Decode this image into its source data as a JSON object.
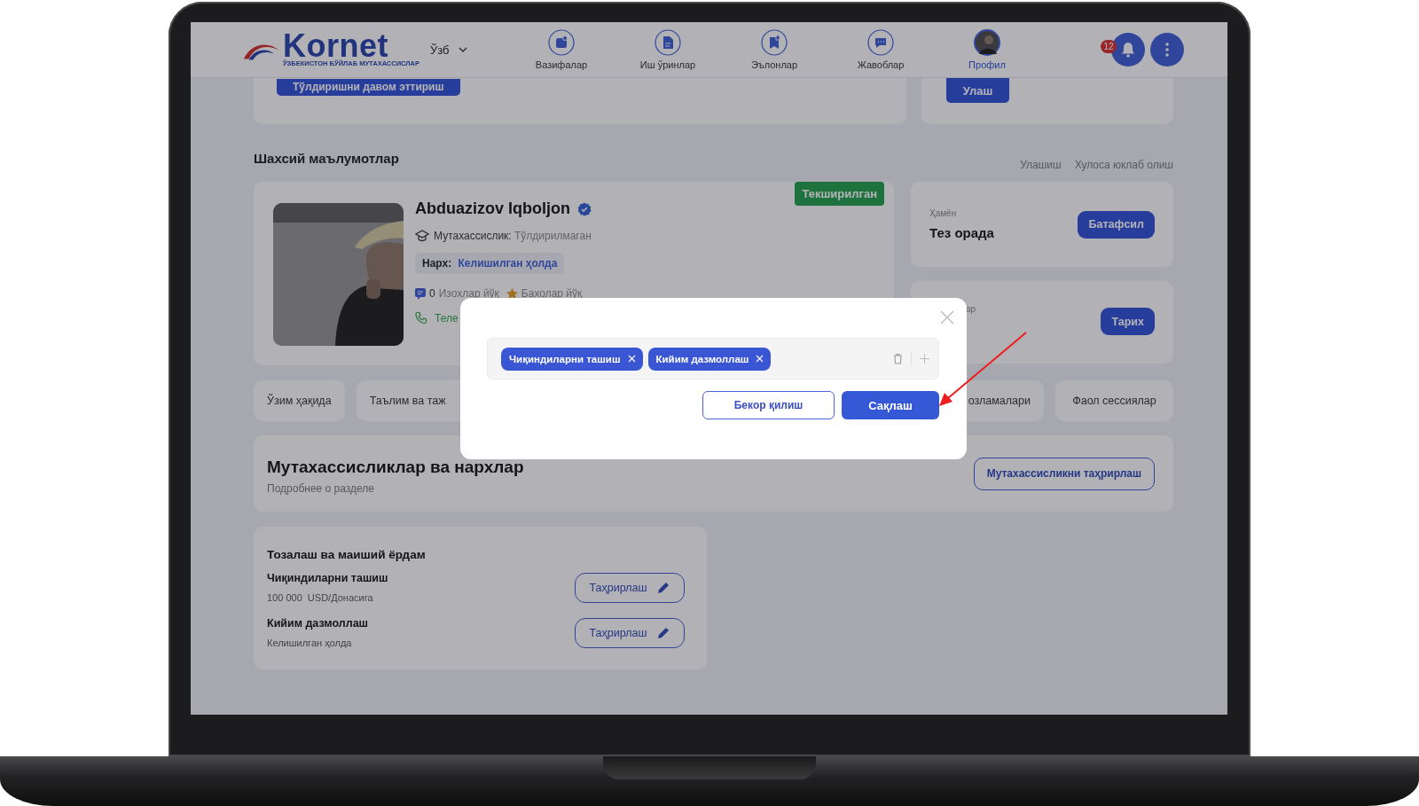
{
  "header": {
    "logo": "Kornet",
    "logo_tagline": "ЎЗБЕКИСТОН БЎЙЛАБ МУТАХАССИСЛАР",
    "language": "Ўзб",
    "nav": [
      {
        "label": "Вазифалар",
        "selected": false
      },
      {
        "label": "Иш ўринлар",
        "selected": false
      },
      {
        "label": "Эълонлар",
        "selected": false
      },
      {
        "label": "Жавоблар",
        "selected": false
      },
      {
        "label": "Профил",
        "selected": true
      }
    ],
    "notifications_count": "12"
  },
  "top_cards": {
    "continue_button": "Тўлдиришни давом эттириш",
    "connect_button": "Улаш"
  },
  "personal": {
    "title": "Шахсий маълумотлар",
    "links": [
      "Улашиш",
      "Хулоса юклаб олиш"
    ],
    "profile": {
      "name": "Abduazizov Iqboljon",
      "verified": true,
      "status": "Текширилган",
      "specialty_label": "Мутахассислик:",
      "specialty_value": "Тўлдирилмаган",
      "price_label": "Нарх:",
      "price_value": "Келишилган ҳолда",
      "reviews_count": "0",
      "reviews": "Изохлар йўқ",
      "ratings": "Бахолар йўқ",
      "phone": "Теле"
    },
    "wallet": {
      "label": "Ҳамён",
      "value": "Тез орада",
      "button": "Батафсил"
    },
    "history": {
      "label": "ар",
      "button": "Тарих"
    }
  },
  "tabs": [
    {
      "label": "Ўзим ҳақида",
      "selected": false
    },
    {
      "label": "Таълим ва таж",
      "selected": false
    },
    {
      "label": "озламалари",
      "selected": false
    },
    {
      "label": "Фаол сессиялар",
      "selected": false
    }
  ],
  "specialties": {
    "title": "Мутахассисликлар ва нархлар",
    "subtitle": "Подробнее о разделе",
    "edit_button": "Мутахассисликни таҳрирлаш"
  },
  "category": {
    "title": "Тозалаш ва маиший ёрдам",
    "items": [
      {
        "name": "Чиқиндиларни ташиш",
        "price": "100 000  USD/Донасига",
        "button": "Таҳрирлаш"
      },
      {
        "name": "Кийим дазмоллаш",
        "price": "Келишилган ҳолда",
        "button": "Таҳрирлаш"
      }
    ]
  },
  "modal": {
    "tags": [
      "Чиқиндиларни ташиш",
      "Кийим дазмоллаш"
    ],
    "cancel_button": "Бекор қилиш",
    "save_button": "Сақлаш"
  }
}
